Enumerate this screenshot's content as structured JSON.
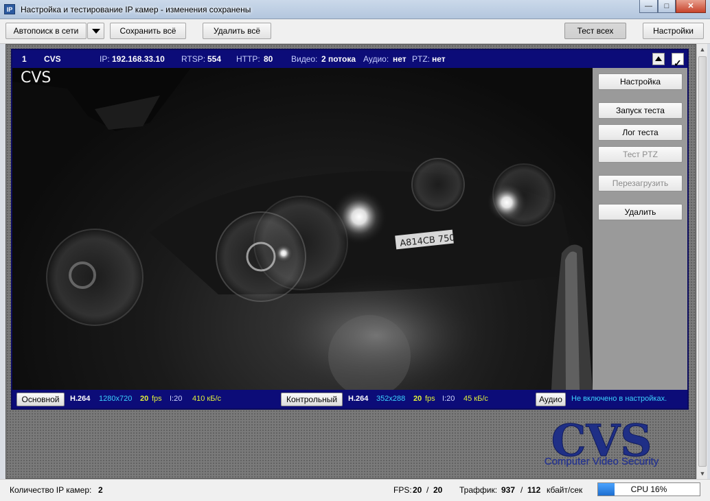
{
  "window": {
    "app_icon": "IP",
    "title": "Настройка и тестирование IP камер - изменения сохранены",
    "minimize_icon": "minimize-icon",
    "maximize_icon": "maximize-icon",
    "close_icon": "close-icon"
  },
  "toolbar": {
    "autosearch": "Автопоиск в сети",
    "save_all": "Сохранить всё",
    "delete_all": "Удалить всё",
    "test_all": "Тест всех",
    "settings": "Настройки"
  },
  "camera": {
    "number": "1",
    "name": "CVS",
    "ip_label": "IP:",
    "ip": "192.168.33.10",
    "rtsp_label": "RTSP:",
    "rtsp": "554",
    "http_label": "HTTP:",
    "http": "80",
    "video_label": "Видео:",
    "video": "2 потока",
    "audio_label": "Аудио:",
    "audio": "нет",
    "ptz_label": "PTZ:",
    "ptz": "нет",
    "overlay_name": "CVS",
    "plate": "A814CB 750",
    "enabled": true
  },
  "side_buttons": {
    "setup": "Настройка",
    "run_test": "Запуск теста",
    "test_log": "Лог теста",
    "test_ptz": "Тест PTZ",
    "reboot": "Перезагрузить",
    "delete": "Удалить"
  },
  "streams": {
    "main": {
      "button": "Основной",
      "codec": "H.264",
      "resolution": "1280x720",
      "fps_value": "20",
      "fps_unit": "fps",
      "iframe": "I:20",
      "bitrate": "410 кБ/с"
    },
    "control": {
      "button": "Контрольный",
      "codec": "H.264",
      "resolution": "352x288",
      "fps_value": "20",
      "fps_unit": "fps",
      "iframe": "I:20",
      "bitrate": "45 кБ/с"
    },
    "audio": {
      "button": "Аудио",
      "status": "Не включено в настройках."
    }
  },
  "logo": {
    "text": "CVS",
    "tagline": "Computer Video Security"
  },
  "status": {
    "cameras_label": "Количество IP камер:",
    "cameras_count": "2",
    "fps_label": "FPS:",
    "fps_current": "20",
    "fps_sep": "/",
    "fps_total": "20",
    "traffic_label": "Траффик:",
    "traffic_in": "937",
    "traffic_sep": "/",
    "traffic_out": "112",
    "traffic_unit": "кбайт/сек",
    "cpu_text": "CPU 16%",
    "cpu_percent": 16
  },
  "colors": {
    "header_bg": "#0c0c78",
    "cyan": "#3cd3ff",
    "yellow": "#e0ef3c",
    "logo_blue": "#1f2f86"
  }
}
